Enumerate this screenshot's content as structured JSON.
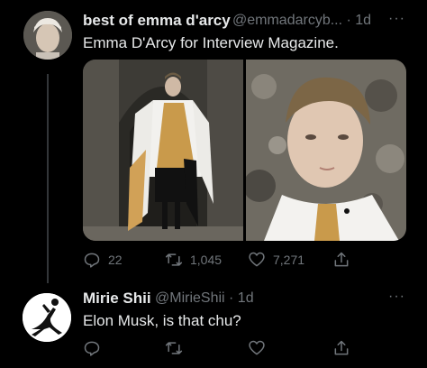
{
  "tweet1": {
    "display_name": "best of emma d'arcy",
    "handle_time": "@emmadarcyb... · 1d",
    "text": "Emma D'Arcy for Interview Magazine.",
    "more": "···",
    "actions": {
      "replies": "22",
      "retweets": "1,045",
      "likes": "7,271"
    }
  },
  "tweet2": {
    "display_name": "Mirie Shii",
    "handle_time": "@MirieShii · 1d",
    "text": "Elon Musk, is that chu?",
    "more": "···"
  },
  "colors": {
    "background": "#000000",
    "primary_text": "#e7e9ea",
    "secondary_text": "#71767b",
    "divider": "#2f3336"
  },
  "icons": [
    "reply-icon",
    "retweet-icon",
    "like-icon",
    "share-icon",
    "more-icon"
  ]
}
